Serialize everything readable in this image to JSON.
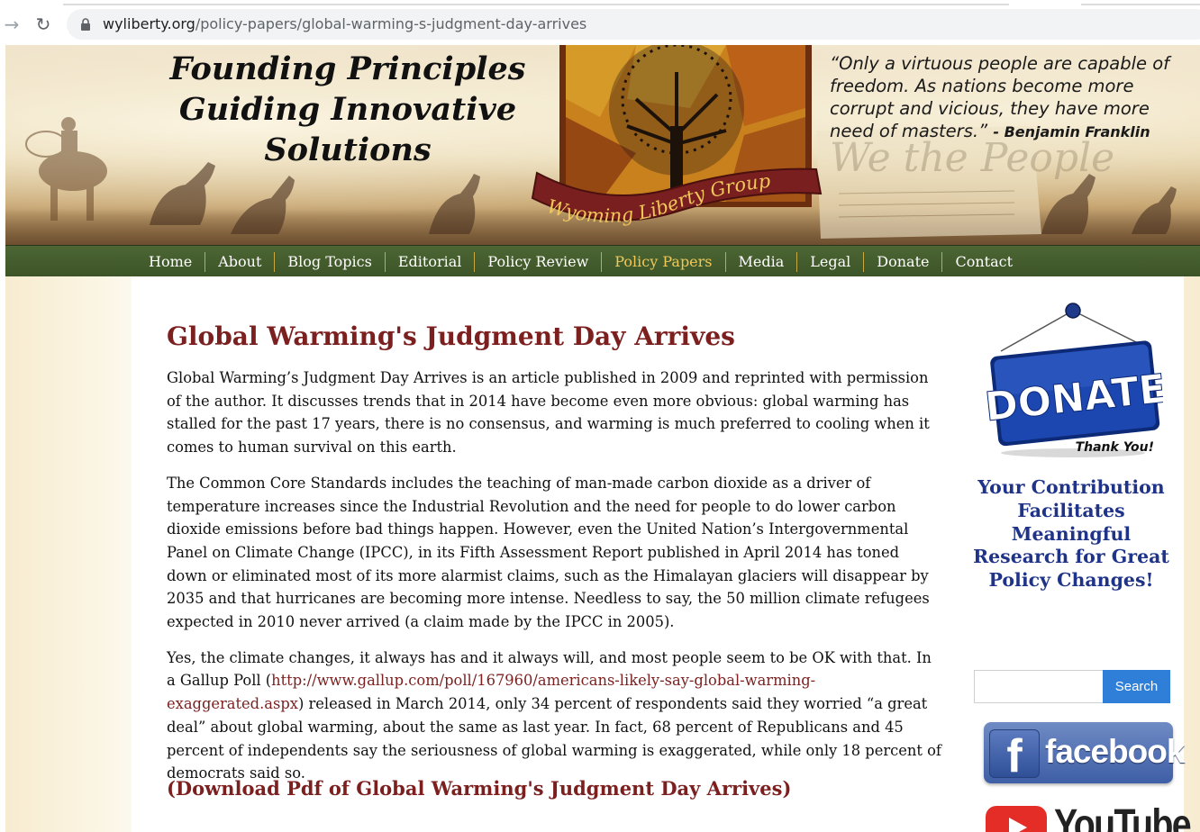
{
  "browser": {
    "url_domain": "wyliberty.org",
    "url_path": "/policy-papers/global-warming-s-judgment-day-arrives"
  },
  "header": {
    "tagline_line1": "Founding Principles",
    "tagline_line2": "Guiding Innovative",
    "tagline_line3": "Solutions",
    "logo_text": "Wyoming Liberty Group",
    "quote_text": "“Only a virtuous people are capable of freedom. As nations become more corrupt and vicious, they have more need of masters.”",
    "quote_author": "- Benjamin Franklin",
    "watermark_text": "We the People"
  },
  "nav": {
    "items": [
      {
        "label": "Home"
      },
      {
        "label": "About"
      },
      {
        "label": "Blog Topics"
      },
      {
        "label": "Editorial"
      },
      {
        "label": "Policy Review"
      },
      {
        "label": "Policy Papers"
      },
      {
        "label": "Media"
      },
      {
        "label": "Legal"
      },
      {
        "label": "Donate"
      },
      {
        "label": "Contact"
      }
    ],
    "active": "Policy Papers",
    "active_color": "#f0c85a"
  },
  "article": {
    "title": "Global Warming's Judgment Day Arrives",
    "p1": "Global Warming’s Judgment Day Arrives is an article published in 2009 and reprinted with permission of the author. It discusses trends that in 2014 have become even more obvious: global warming has stalled for the past 17 years, there is no consensus, and warming is much preferred to cooling when it comes to human survival on this earth.",
    "p2": "The Common Core Standards includes the teaching of man-made carbon dioxide as a driver of temperature increases since the Industrial Revolution and the need for people to do lower carbon dioxide emissions before bad things happen. However, even the United Nation’s Intergovernmental Panel on Climate Change (IPCC), in its Fifth Assessment Report published in April 2014 has toned down or eliminated most of its more alarmist claims, such as the Himalayan glaciers will disappear by 2035 and that hurricanes are becoming more intense. Needless to say, the 50 million climate refugees expected in 2010 never arrived (a claim made by the IPCC in 2005).",
    "p3_before": "Yes, the climate changes, it always has and it always will, and most people seem to be OK with that. In a Gallup Poll (",
    "p3_link": "http://www.gallup.com/poll/167960/americans-likely-say-global-warming-exaggerated.aspx",
    "p3_after": ") released in March 2014, only 34 percent of respondents said they worried “a great deal” about global warming, about the same as last year. In fact, 68 percent of Republicans and 45 percent of independents say the seriousness of global warming is exaggerated, while only 18 percent of democrats said so.",
    "download_label": "(Download Pdf of Global Warming's Judgment Day Arrives)",
    "title_color": "#7b1f1f"
  },
  "sidebar": {
    "donate_label": "DONATE",
    "donate_thanks": "Thank You!",
    "contribution_text": "Your Contribution Facilitates Meaningful Research for Great Policy Changes!",
    "search_value": "",
    "search_button": "Search",
    "facebook_label": "facebook",
    "youtube_label": "YouTube",
    "contribution_color": "#1f3488"
  }
}
